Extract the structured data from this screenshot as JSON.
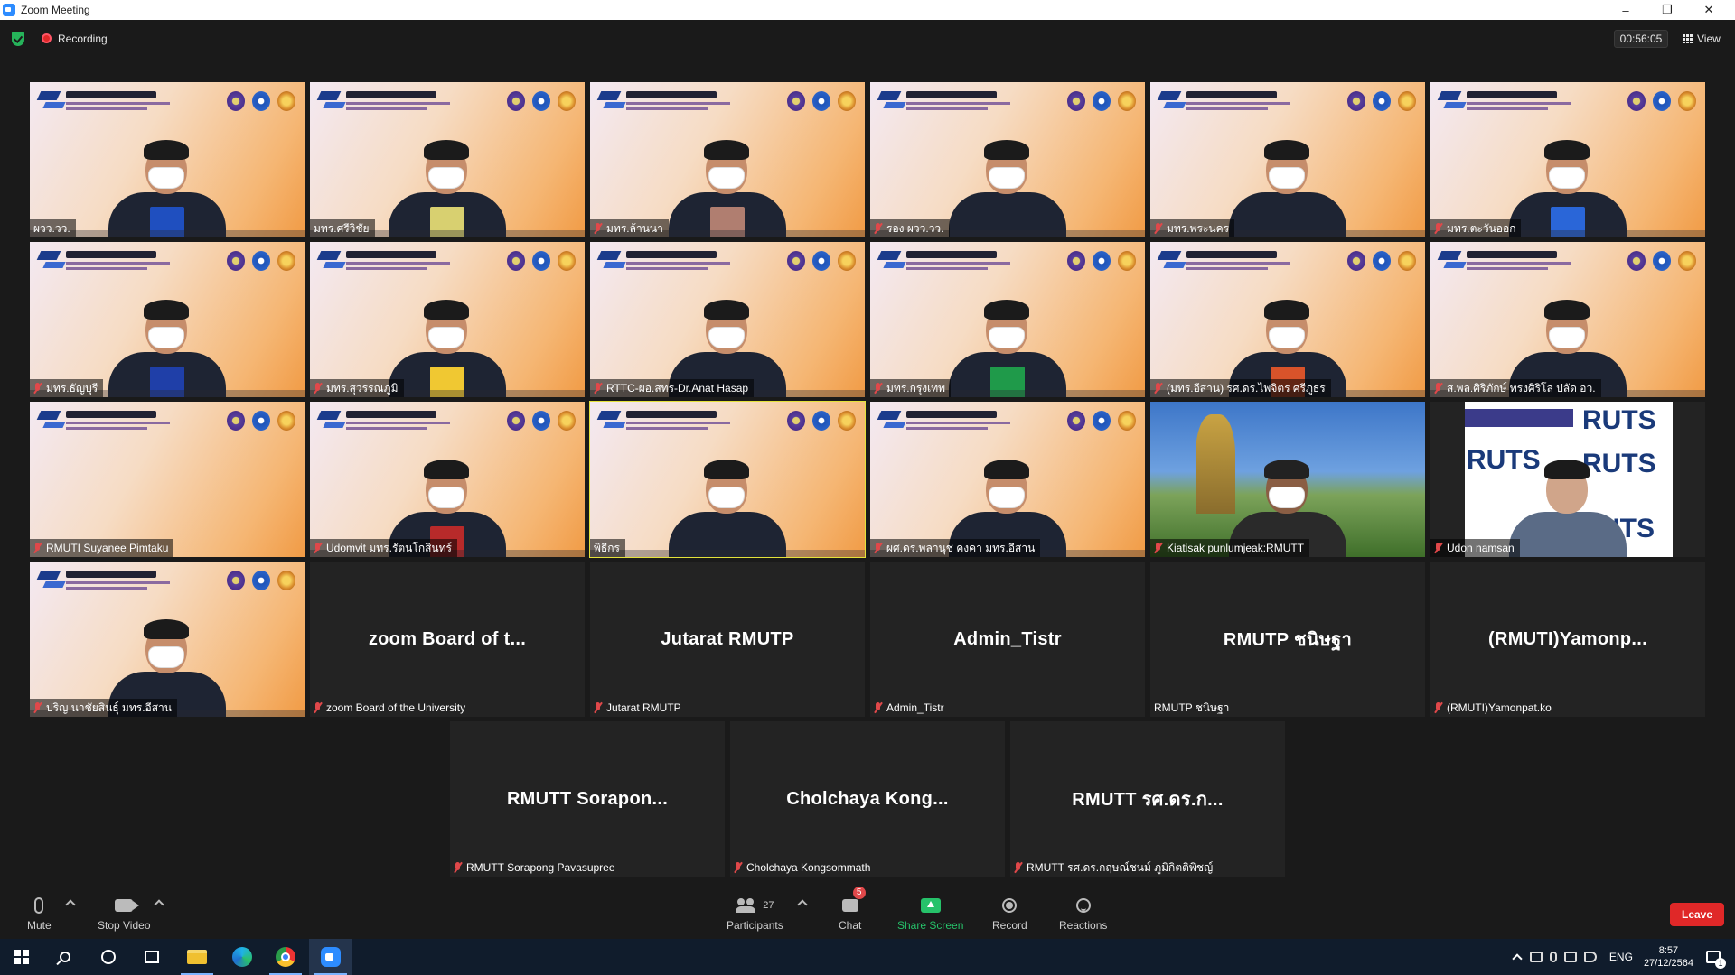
{
  "window": {
    "title": "Zoom Meeting",
    "controls": [
      "–",
      "❐",
      "✕"
    ]
  },
  "topbar": {
    "recording_label": "Recording",
    "timer": "00:56:05",
    "view_label": "View"
  },
  "tiles": [
    {
      "label": "ผวว.วว.",
      "muted": false,
      "kind": "ceremony",
      "folder": "#1f4fbf"
    },
    {
      "label": "มทร.ศรีวิชัย",
      "muted": false,
      "kind": "ceremony",
      "folder": "#d8d070"
    },
    {
      "label": "มทร.ล้านนา",
      "muted": true,
      "kind": "ceremony",
      "folder": "#b07e70"
    },
    {
      "label": "รอง ผวว.วว.",
      "muted": true,
      "kind": "ceremony",
      "folder": ""
    },
    {
      "label": "มทร.พระนคร",
      "muted": true,
      "kind": "ceremony",
      "folder": ""
    },
    {
      "label": "มทร.ตะวันออก",
      "muted": true,
      "kind": "ceremony",
      "folder": "#2a66d8"
    },
    {
      "label": "มทร.ธัญบุรี",
      "muted": true,
      "kind": "ceremony",
      "folder": "#1f3fa8"
    },
    {
      "label": "มทร.สุวรรณภูมิ",
      "muted": true,
      "kind": "ceremony",
      "folder": "#f0c832"
    },
    {
      "label": "RTTC-ผอ.สทร-Dr.Anat Hasap",
      "muted": true,
      "kind": "ceremony",
      "folder": ""
    },
    {
      "label": "มทร.กรุงเทพ",
      "muted": true,
      "kind": "ceremony",
      "folder": "#1f9a4a"
    },
    {
      "label": "(มทร.อีสาน) รศ.ดร.ไพจิตร ศรีภูธร",
      "muted": true,
      "kind": "ceremony",
      "folder": "#d8532a"
    },
    {
      "label": "ส.พล.ศิริภักษ์ ทรงศิริโล ปลัด อว.",
      "muted": true,
      "kind": "ceremony",
      "folder": ""
    },
    {
      "label": "RMUTI Suyanee Pimtaku",
      "muted": true,
      "kind": "ceremony-empty",
      "folder": ""
    },
    {
      "label": "Udomvit มทร.รัตนโกสินทร์",
      "muted": true,
      "kind": "ceremony",
      "folder": "#b82a2a"
    },
    {
      "label": "พิธีกร",
      "muted": false,
      "kind": "ceremony",
      "folder": "",
      "active": true
    },
    {
      "label": "ผศ.ดร.พลานุช คงคา มทร.อีสาน",
      "muted": true,
      "kind": "ceremony",
      "folder": ""
    },
    {
      "label": "Kiatisak punlumjeak:RMUTT",
      "muted": true,
      "kind": "outdoor",
      "folder": ""
    },
    {
      "label": "Udon  namsan",
      "muted": true,
      "kind": "ruts",
      "folder": ""
    },
    {
      "label": "ปริญ นาชัยสินธุ์ มทร.อีสาน",
      "muted": true,
      "kind": "ceremony",
      "folder": ""
    },
    {
      "label": "zoom Board of the University",
      "muted": true,
      "kind": "name",
      "display": "zoom Board of t..."
    },
    {
      "label": "Jutarat RMUTP",
      "muted": true,
      "kind": "name",
      "display": "Jutarat RMUTP"
    },
    {
      "label": "Admin_Tistr",
      "muted": true,
      "kind": "name",
      "display": "Admin_Tistr"
    },
    {
      "label": "RMUTP ชนิษฐา",
      "muted": false,
      "kind": "name",
      "display": "RMUTP ชนิษฐา"
    },
    {
      "label": "(RMUTI)Yamonpat.ko",
      "muted": true,
      "kind": "name",
      "display": "(RMUTI)Yamonp..."
    },
    {
      "label": "RMUTT Sorapong Pavasupree",
      "muted": true,
      "kind": "name",
      "display": "RMUTT  Sorapon..."
    },
    {
      "label": "Cholchaya Kongsommath",
      "muted": true,
      "kind": "name",
      "display": "Cholchaya  Kong..."
    },
    {
      "label": "RMUTT รศ.ดร.กฤษณ์ชนม์ ภูมิกิตติพิชญ์",
      "muted": true,
      "kind": "name",
      "display": "RMUTT  รศ.ดร.ก..."
    }
  ],
  "ruts_text": [
    "RUTS",
    "RUTS",
    "RUTS",
    "UTS"
  ],
  "toolbar": {
    "mute": "Mute",
    "stop_video": "Stop Video",
    "participants": "Participants",
    "participants_count": "27",
    "chat": "Chat",
    "chat_badge": "5",
    "share_screen": "Share Screen",
    "record": "Record",
    "reactions": "Reactions",
    "leave": "Leave"
  },
  "taskbar": {
    "language": "ENG",
    "time": "8:57",
    "date": "27/12/2564",
    "notifications": "1"
  }
}
